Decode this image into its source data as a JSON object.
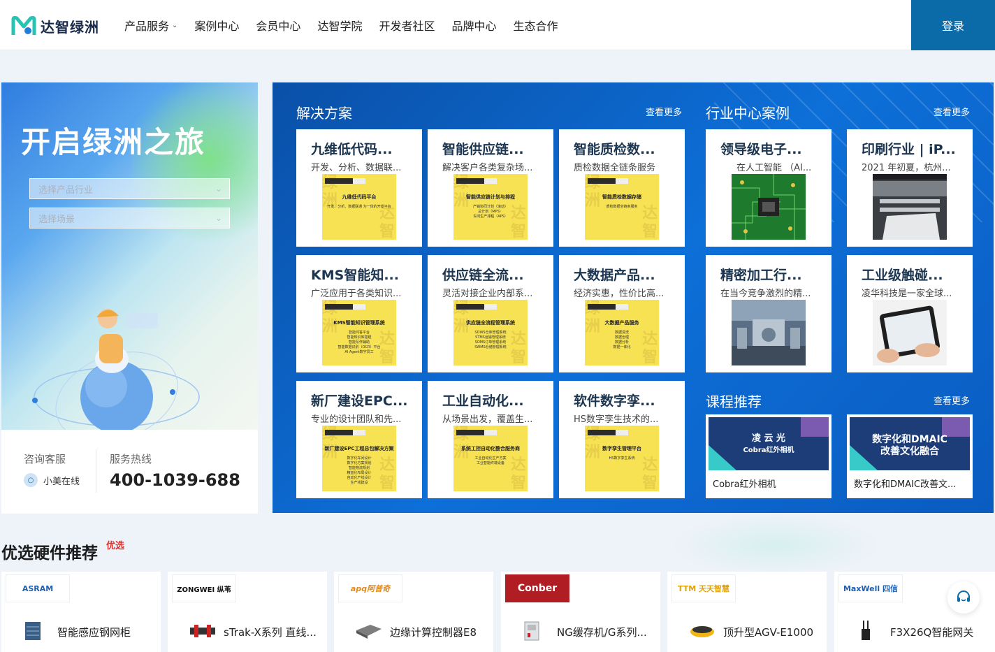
{
  "header": {
    "logo_text": "达智绿洲",
    "nav": [
      {
        "label": "产品服务",
        "has_dropdown": true
      },
      {
        "label": "案例中心"
      },
      {
        "label": "会员中心"
      },
      {
        "label": "达智学院"
      },
      {
        "label": "开发者社区"
      },
      {
        "label": "品牌中心"
      },
      {
        "label": "生态合作"
      }
    ],
    "login_label": "登录"
  },
  "hero": {
    "title": "开启绿洲之旅",
    "select_industry": "选择产品行业",
    "select_scene": "选择场景"
  },
  "contact": {
    "consult_label": "咨询客服",
    "online_label": "小美在线",
    "hotline_label": "服务热线",
    "phone": "400-1039-688"
  },
  "solutions": {
    "title": "解决方案",
    "more": "查看更多",
    "cards": [
      {
        "title": "九维低代码...",
        "sub": "开发、分析、数据联...",
        "thumb_title": "九维低代码平台",
        "thumb_lines": [
          "开发、分析、数据联通 为一体的开发平台"
        ]
      },
      {
        "title": "智能供应链...",
        "sub": "解决客户各类复杂场...",
        "thumb_title": "智能供应链计划与排程",
        "thumb_lines": [
          "产销协同计划（滚动）",
          "总计划（MPS）",
          "车间生产排程（APS）"
        ]
      },
      {
        "title": "智能质检数...",
        "sub": "质检数据全链条服务",
        "thumb_title": "智能质检数据存储",
        "thumb_lines": [
          "质检数据全链条服务"
        ]
      },
      {
        "title": "KMS智能知...",
        "sub": "广泛应用于各类知识...",
        "thumb_title": "KMS智能知识管理系统",
        "thumb_lines": [
          "智能问答平台",
          "智能知识库搭建",
          "智能写作辅助",
          "智能数据识别（OCR）平台",
          "AI Agent数字员工"
        ]
      },
      {
        "title": "供应链全流...",
        "sub": "灵活对接企业内部系...",
        "thumb_title": "供应链全流程管理系统",
        "thumb_lines": [
          "SDWS仓库管理系统",
          "STMS运输管理系统",
          "SOMS订单管理系统",
          "SWMS仓储管理系统"
        ]
      },
      {
        "title": "大数据产品...",
        "sub": "经济实惠，性价比高...",
        "thumb_title": "大数据产品服务",
        "thumb_lines": [
          "数据清洗",
          "数据治理",
          "数据分析",
          "数据一体化"
        ]
      },
      {
        "title": "新厂建设EPC...",
        "sub": "专业的设计团队和先...",
        "thumb_title": "新厂建设EPC工程总包解决方案",
        "thumb_lines": [
          "数字化车间设计",
          "数字化方案规划",
          "智能物流规划",
          "精益化布局设计",
          "自动化产线设计",
          "生产线建设"
        ]
      },
      {
        "title": "工业自动化...",
        "sub": "从场景出发，覆盖生...",
        "thumb_title": "系统工控自动化整合服务商",
        "thumb_lines": [
          "工业自动化生产方案",
          "工业智能终端设备"
        ]
      },
      {
        "title": "软件数字孪...",
        "sub": "HS数字孪生技术的...",
        "thumb_title": "数字孪生管理平台",
        "thumb_lines": [
          "HS数字孪生系统"
        ]
      }
    ]
  },
  "industry": {
    "title": "行业中心案例",
    "more": "查看更多",
    "cards": [
      {
        "title": "领导级电子...",
        "sub": "在人工智能 （AI..."
      },
      {
        "title": "印刷行业 | iP...",
        "sub": "2021 年初夏，杭州..."
      },
      {
        "title": "精密加工行...",
        "sub": "在当今竞争激烈的精..."
      },
      {
        "title": "工业级触碰...",
        "sub": "凌华科技是一家全球..."
      }
    ]
  },
  "courses": {
    "title": "课程推荐",
    "more": "查看更多",
    "items": [
      {
        "img_line1": "凌 云 光",
        "img_line2": "Cobra红外相机",
        "label": "Cobra红外相机"
      },
      {
        "img_line1": "数字化和DMAIC",
        "img_line2": "改善文化融合",
        "label": "数字化和DMAIC改善文..."
      }
    ]
  },
  "hardware": {
    "title": "优选硬件推荐",
    "badge": "优选",
    "items": [
      {
        "brand": "ASRAM",
        "name": "智能感应钢网柜"
      },
      {
        "brand": "ZONGWEI 纵苇",
        "name": "sTrak-X系列 直线..."
      },
      {
        "brand": "apq阿普奇",
        "name": "边缘计算控制器E8"
      },
      {
        "brand": "Conber",
        "name": "NG缓存机/G系列..."
      },
      {
        "brand": "TTM 天天智慧",
        "name": "顶升型AGV-E1000"
      },
      {
        "brand": "MaxWell 四信",
        "name": "F3X26Q智能网关"
      }
    ]
  },
  "colors": {
    "login_bg": "#0b6aa8",
    "panel_bg": "#0d6fd8",
    "thumb_yellow": "#f7e253",
    "badge_red": "#e4322b"
  }
}
